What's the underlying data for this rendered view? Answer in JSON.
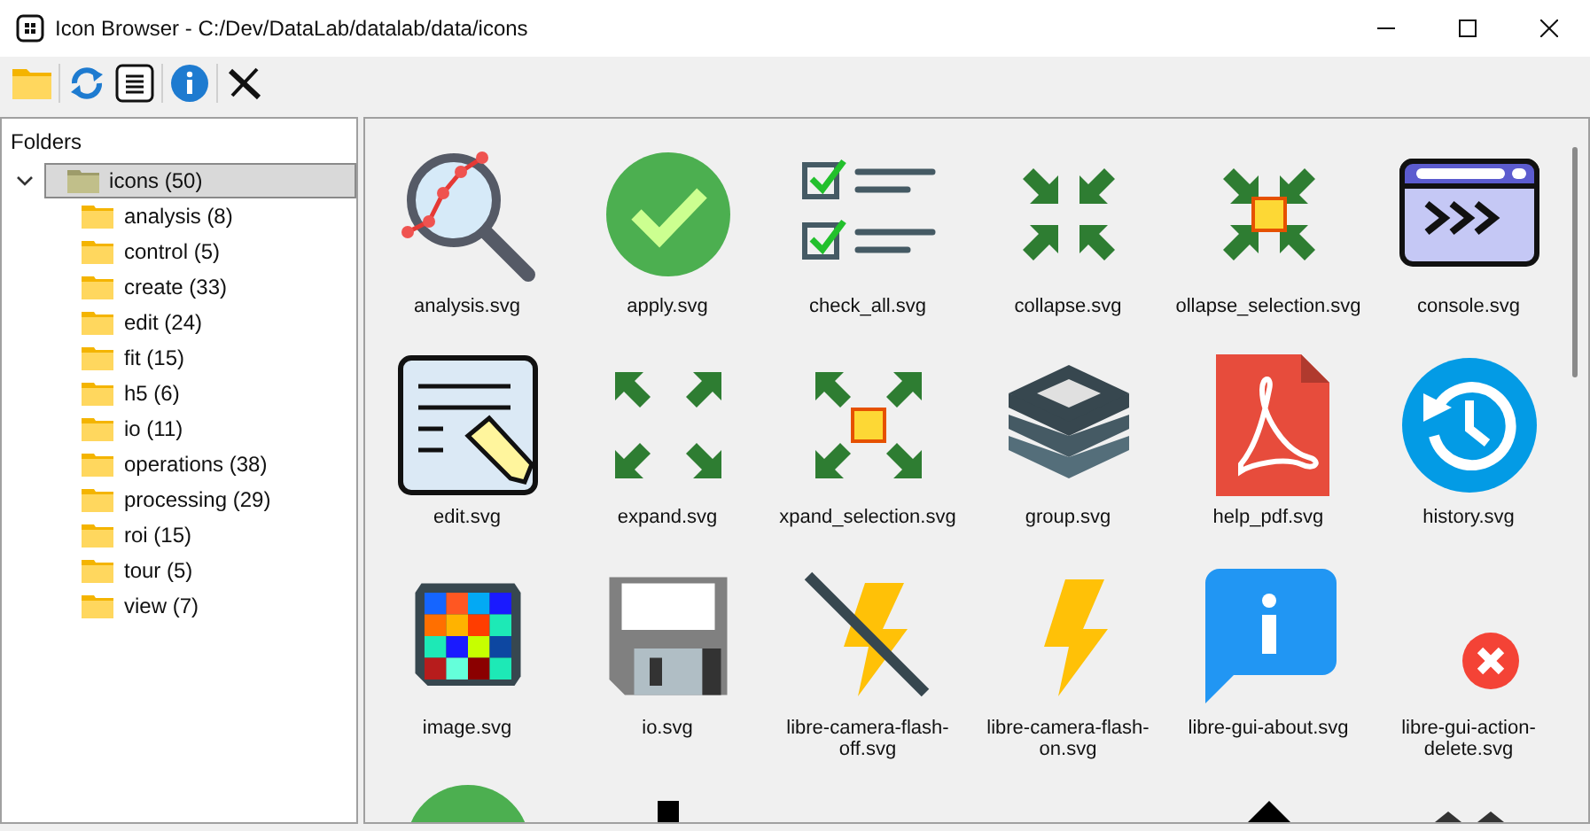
{
  "window": {
    "title": "Icon Browser - C:/Dev/DataLab/datalab/data/icons"
  },
  "tree": {
    "header": "Folders",
    "items": [
      {
        "label": "icons (50)",
        "selected": true,
        "expanded": true,
        "children": [
          {
            "label": "analysis (8)",
            "selected": false
          },
          {
            "label": "control (5)",
            "selected": false
          },
          {
            "label": "create (33)",
            "selected": false
          },
          {
            "label": "edit (24)",
            "selected": false
          },
          {
            "label": "fit (15)",
            "selected": false
          },
          {
            "label": "h5 (6)",
            "selected": false
          },
          {
            "label": "io (11)",
            "selected": false
          },
          {
            "label": "operations (38)",
            "selected": false
          },
          {
            "label": "processing (29)",
            "selected": false
          },
          {
            "label": "roi (15)",
            "selected": false
          },
          {
            "label": "tour (5)",
            "selected": false
          },
          {
            "label": "view (7)",
            "selected": false
          }
        ]
      }
    ]
  },
  "icons": [
    {
      "kind": "analysis",
      "label": "analysis.svg"
    },
    {
      "kind": "apply",
      "label": "apply.svg"
    },
    {
      "kind": "check_all",
      "label": "check_all.svg"
    },
    {
      "kind": "collapse",
      "label": "collapse.svg"
    },
    {
      "kind": "collapse_selection",
      "label": "ollapse_selection.svg"
    },
    {
      "kind": "console",
      "label": "console.svg"
    },
    {
      "kind": "edit",
      "label": "edit.svg"
    },
    {
      "kind": "expand",
      "label": "expand.svg"
    },
    {
      "kind": "expand_selection",
      "label": "xpand_selection.svg"
    },
    {
      "kind": "group",
      "label": "group.svg"
    },
    {
      "kind": "pdf",
      "label": "help_pdf.svg"
    },
    {
      "kind": "history",
      "label": "history.svg"
    },
    {
      "kind": "image",
      "label": "image.svg"
    },
    {
      "kind": "io",
      "label": "io.svg"
    },
    {
      "kind": "flash_off",
      "label": "libre-camera-flash-off.svg"
    },
    {
      "kind": "flash_on",
      "label": "libre-camera-flash-on.svg"
    },
    {
      "kind": "about",
      "label": "libre-gui-about.svg"
    },
    {
      "kind": "delete",
      "label": "libre-gui-action-delete.svg"
    },
    {
      "kind": "partial_circle"
    },
    {
      "kind": "partial_square"
    },
    {
      "kind": "blank"
    },
    {
      "kind": "blank"
    },
    {
      "kind": "partial_triangle"
    },
    {
      "kind": "partial_triangles"
    }
  ]
}
